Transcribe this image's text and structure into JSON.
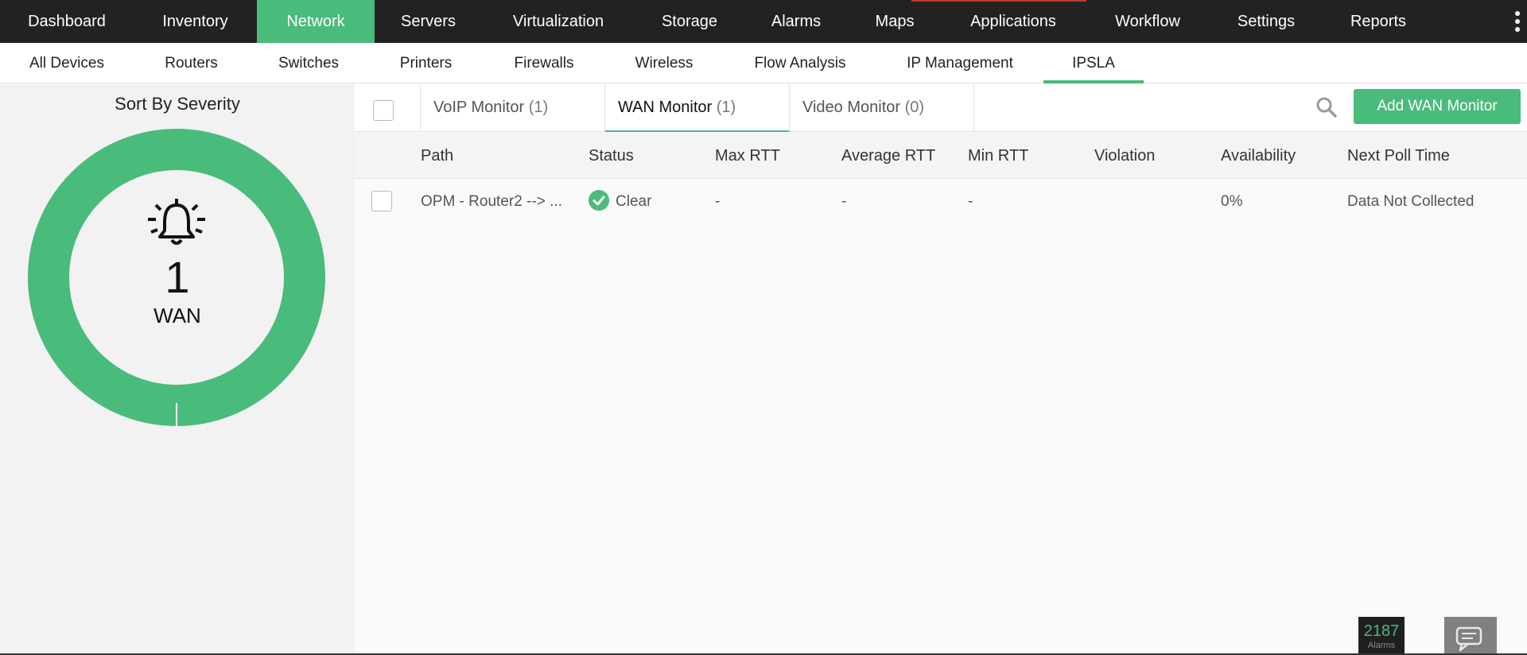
{
  "top_nav": {
    "items": [
      {
        "label": "Dashboard"
      },
      {
        "label": "Inventory"
      },
      {
        "label": "Network"
      },
      {
        "label": "Servers"
      },
      {
        "label": "Virtualization"
      },
      {
        "label": "Storage"
      },
      {
        "label": "Alarms"
      },
      {
        "label": "Maps"
      },
      {
        "label": "Applications"
      },
      {
        "label": "Workflow"
      },
      {
        "label": "Settings"
      },
      {
        "label": "Reports"
      }
    ],
    "active": "Network"
  },
  "sub_nav": {
    "items": [
      {
        "label": "All Devices"
      },
      {
        "label": "Routers"
      },
      {
        "label": "Switches"
      },
      {
        "label": "Printers"
      },
      {
        "label": "Firewalls"
      },
      {
        "label": "Wireless"
      },
      {
        "label": "Flow Analysis"
      },
      {
        "label": "IP Management"
      },
      {
        "label": "IPSLA"
      }
    ],
    "active": "IPSLA"
  },
  "severity_panel": {
    "heading": "Sort By Severity",
    "count": "1",
    "label": "WAN",
    "ring_color": "#49bb7b",
    "icon": "bell-icon"
  },
  "tabs": [
    {
      "name": "VoIP Monitor",
      "count": "(1)"
    },
    {
      "name": "WAN Monitor",
      "count": "(1)"
    },
    {
      "name": "Video Monitor",
      "count": "(0)"
    }
  ],
  "active_tab": "WAN Monitor",
  "add_button": "Add WAN Monitor",
  "table": {
    "columns": [
      "Path",
      "Status",
      "Max RTT",
      "Average RTT",
      "Min RTT",
      "Violation",
      "Availability",
      "Next Poll Time"
    ],
    "rows": [
      {
        "path": "OPM - Router2 --> ...",
        "status": "Clear",
        "max_rtt": "-",
        "average_rtt": "-",
        "min_rtt": "-",
        "violation": "",
        "availability": "0%",
        "next_poll_time": "Data Not Collected"
      }
    ]
  },
  "alarms_widget": {
    "count": "2187",
    "label": "Alarms"
  },
  "colors": {
    "accent": "#49bb7b",
    "nav_bg": "#222222"
  }
}
